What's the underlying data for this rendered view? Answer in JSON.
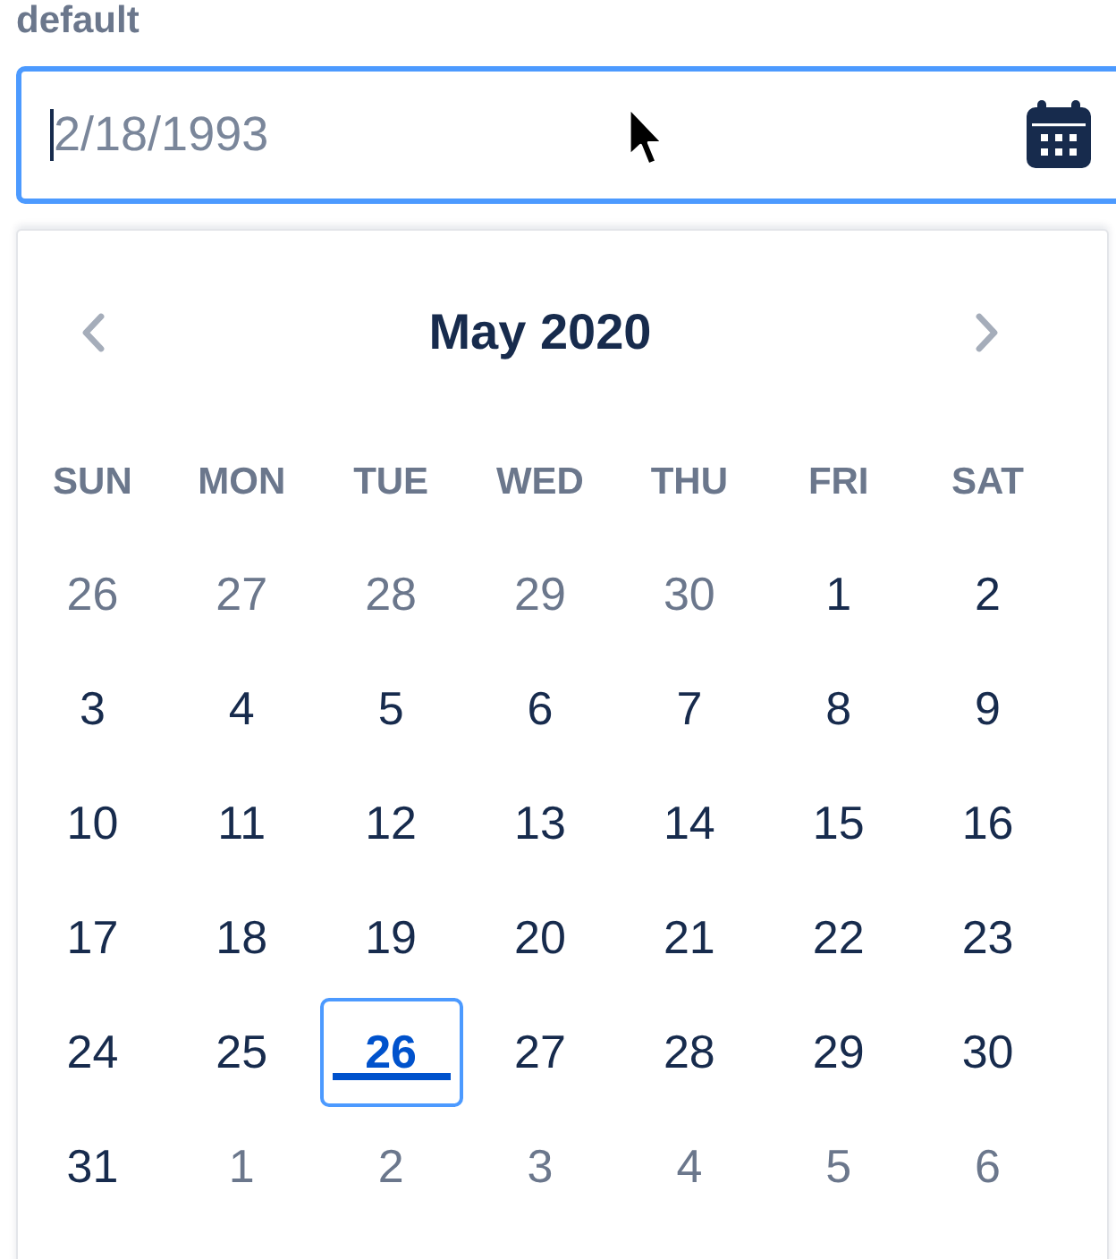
{
  "label": "default",
  "date_field": {
    "placeholder": "2/18/1993",
    "focused": true
  },
  "calendar": {
    "title": "May 2020",
    "weekdays": [
      "SUN",
      "MON",
      "TUE",
      "WED",
      "THU",
      "FRI",
      "SAT"
    ],
    "weeks": [
      {
        "days": [
          {
            "label": "26",
            "in_month": false,
            "today": false,
            "selected": false
          },
          {
            "label": "27",
            "in_month": false,
            "today": false,
            "selected": false
          },
          {
            "label": "28",
            "in_month": false,
            "today": false,
            "selected": false
          },
          {
            "label": "29",
            "in_month": false,
            "today": false,
            "selected": false
          },
          {
            "label": "30",
            "in_month": false,
            "today": false,
            "selected": false
          },
          {
            "label": "1",
            "in_month": true,
            "today": false,
            "selected": false
          },
          {
            "label": "2",
            "in_month": true,
            "today": false,
            "selected": false
          }
        ]
      },
      {
        "days": [
          {
            "label": "3",
            "in_month": true,
            "today": false,
            "selected": false
          },
          {
            "label": "4",
            "in_month": true,
            "today": false,
            "selected": false
          },
          {
            "label": "5",
            "in_month": true,
            "today": false,
            "selected": false
          },
          {
            "label": "6",
            "in_month": true,
            "today": false,
            "selected": false
          },
          {
            "label": "7",
            "in_month": true,
            "today": false,
            "selected": false
          },
          {
            "label": "8",
            "in_month": true,
            "today": false,
            "selected": false
          },
          {
            "label": "9",
            "in_month": true,
            "today": false,
            "selected": false
          }
        ]
      },
      {
        "days": [
          {
            "label": "10",
            "in_month": true,
            "today": false,
            "selected": false
          },
          {
            "label": "11",
            "in_month": true,
            "today": false,
            "selected": false
          },
          {
            "label": "12",
            "in_month": true,
            "today": false,
            "selected": false
          },
          {
            "label": "13",
            "in_month": true,
            "today": false,
            "selected": false
          },
          {
            "label": "14",
            "in_month": true,
            "today": false,
            "selected": false
          },
          {
            "label": "15",
            "in_month": true,
            "today": false,
            "selected": false
          },
          {
            "label": "16",
            "in_month": true,
            "today": false,
            "selected": false
          }
        ]
      },
      {
        "days": [
          {
            "label": "17",
            "in_month": true,
            "today": false,
            "selected": false
          },
          {
            "label": "18",
            "in_month": true,
            "today": false,
            "selected": false
          },
          {
            "label": "19",
            "in_month": true,
            "today": false,
            "selected": false
          },
          {
            "label": "20",
            "in_month": true,
            "today": false,
            "selected": false
          },
          {
            "label": "21",
            "in_month": true,
            "today": false,
            "selected": false
          },
          {
            "label": "22",
            "in_month": true,
            "today": false,
            "selected": false
          },
          {
            "label": "23",
            "in_month": true,
            "today": false,
            "selected": false
          }
        ]
      },
      {
        "days": [
          {
            "label": "24",
            "in_month": true,
            "today": false,
            "selected": false
          },
          {
            "label": "25",
            "in_month": true,
            "today": false,
            "selected": false
          },
          {
            "label": "26",
            "in_month": true,
            "today": true,
            "selected": true
          },
          {
            "label": "27",
            "in_month": true,
            "today": false,
            "selected": false
          },
          {
            "label": "28",
            "in_month": true,
            "today": false,
            "selected": false
          },
          {
            "label": "29",
            "in_month": true,
            "today": false,
            "selected": false
          },
          {
            "label": "30",
            "in_month": true,
            "today": false,
            "selected": false
          }
        ]
      },
      {
        "days": [
          {
            "label": "31",
            "in_month": true,
            "today": false,
            "selected": false
          },
          {
            "label": "1",
            "in_month": false,
            "today": false,
            "selected": false
          },
          {
            "label": "2",
            "in_month": false,
            "today": false,
            "selected": false
          },
          {
            "label": "3",
            "in_month": false,
            "today": false,
            "selected": false
          },
          {
            "label": "4",
            "in_month": false,
            "today": false,
            "selected": false
          },
          {
            "label": "5",
            "in_month": false,
            "today": false,
            "selected": false
          },
          {
            "label": "6",
            "in_month": false,
            "today": false,
            "selected": false
          }
        ]
      }
    ]
  }
}
